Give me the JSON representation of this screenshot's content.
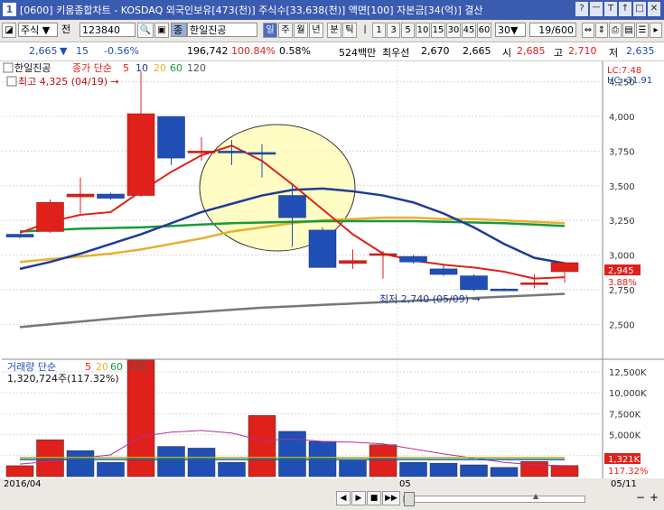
{
  "window": {
    "icon_label": "1",
    "title": "[0600] 키움종합차트 - KOSDAQ 외국인보유[473(천)] 주식수[33,638(천)] 액면[100] 자본금[34(억)] 결산",
    "buttons": [
      "?",
      "ㅡ",
      "T",
      "↑",
      "□",
      "✕"
    ]
  },
  "toolbar": {
    "market": "주식",
    "prev_label": "전",
    "code": "123840",
    "name": "한일진공",
    "search_icon": "search-icon",
    "period_tabs": [
      "일",
      "주",
      "월",
      "년",
      "분",
      "틱"
    ],
    "active_period": "일",
    "intervals": [
      "1",
      "3",
      "5",
      "10",
      "15",
      "30",
      "45",
      "60"
    ],
    "count_value": "30",
    "page_counter": "19/600"
  },
  "quote": {
    "price": "2,665",
    "change": "15",
    "change_pct": "-0.56%",
    "volume": "196,742",
    "vol_ratio": "100.84%",
    "turnover": "0.58%",
    "amount": "524백만",
    "best_bid_label": "최우선",
    "best_bid": "2,670",
    "best_ask": "2,665",
    "open_label": "시",
    "open": "2,685",
    "high_label": "고",
    "high": "2,710",
    "low_label": "저",
    "low": "2,635"
  },
  "colors": {
    "up": "#e0201a",
    "down": "#1f4fb5",
    "ma5": "#e0201a",
    "ma10": "#1f3a9a",
    "ma20": "#e8b030",
    "ma60": "#1a9a3a",
    "ma120": "#777777"
  },
  "chart_data": [
    {
      "type": "candlestick",
      "title": "한일진공",
      "legend": {
        "prefix": "종가 단순",
        "periods": [
          "5",
          "10",
          "20",
          "60",
          "120"
        ]
      },
      "annotations": {
        "high": "최고 4,325 (04/19) →",
        "low": "최저 2,740 (05/09) →",
        "lc": "LC:7.48",
        "hc": "HC:-31.91",
        "last_price": "2,945",
        "last_pct": "3.88%"
      },
      "ylim": [
        2300,
        4300
      ],
      "y_ticks": [
        "4,250",
        "4,000",
        "3,750",
        "3,500",
        "3,250",
        "3,000",
        "2,750",
        "2,500"
      ],
      "y_tick_values": [
        4250,
        4000,
        3750,
        3500,
        3250,
        3000,
        2750,
        2500
      ],
      "x_labels": [
        "2016/04",
        "05",
        "05/11"
      ],
      "candles": [
        {
          "o": 3150,
          "h": 3150,
          "l": 3120,
          "c": 3130
        },
        {
          "o": 3170,
          "h": 3400,
          "l": 3160,
          "c": 3380
        },
        {
          "o": 3420,
          "h": 3560,
          "l": 3300,
          "c": 3440
        },
        {
          "o": 3440,
          "h": 3450,
          "l": 3400,
          "c": 3410
        },
        {
          "o": 3430,
          "h": 4325,
          "l": 3420,
          "c": 4020
        },
        {
          "o": 4000,
          "h": 4000,
          "l": 3650,
          "c": 3700
        },
        {
          "o": 3750,
          "h": 3850,
          "l": 3680,
          "c": 3750
        },
        {
          "o": 3750,
          "h": 3830,
          "l": 3650,
          "c": 3740
        },
        {
          "o": 3740,
          "h": 3800,
          "l": 3560,
          "c": 3730
        },
        {
          "o": 3430,
          "h": 3520,
          "l": 3060,
          "c": 3270
        },
        {
          "o": 3180,
          "h": 3200,
          "l": 2910,
          "c": 2910
        },
        {
          "o": 2940,
          "h": 3040,
          "l": 2900,
          "c": 2960
        },
        {
          "o": 3000,
          "h": 3030,
          "l": 2830,
          "c": 3010
        },
        {
          "o": 2990,
          "h": 3000,
          "l": 2940,
          "c": 2950
        },
        {
          "o": 2900,
          "h": 2930,
          "l": 2850,
          "c": 2860
        },
        {
          "o": 2850,
          "h": 2860,
          "l": 2740,
          "c": 2750
        },
        {
          "o": 2755,
          "h": 2760,
          "l": 2745,
          "c": 2750
        },
        {
          "o": 2800,
          "h": 2860,
          "l": 2760,
          "c": 2800
        },
        {
          "o": 2880,
          "h": 2950,
          "l": 2800,
          "c": 2945
        }
      ],
      "ma5": [
        3160,
        3240,
        3290,
        3310,
        3460,
        3600,
        3720,
        3790,
        3680,
        3510,
        3330,
        3150,
        3010,
        2960,
        2930,
        2910,
        2880,
        2830,
        2840
      ],
      "ma10": [
        2900,
        2950,
        3010,
        3080,
        3150,
        3230,
        3310,
        3370,
        3430,
        3470,
        3480,
        3460,
        3430,
        3380,
        3300,
        3200,
        3080,
        2980,
        2940
      ],
      "ma20": [
        2950,
        2970,
        2990,
        3010,
        3040,
        3080,
        3120,
        3170,
        3200,
        3230,
        3250,
        3260,
        3270,
        3270,
        3260,
        3260,
        3250,
        3240,
        3230
      ],
      "ma60": [
        3170,
        3180,
        3190,
        3195,
        3200,
        3210,
        3220,
        3230,
        3235,
        3240,
        3245,
        3245,
        3245,
        3245,
        3240,
        3235,
        3230,
        3220,
        3210
      ],
      "ma120": [
        2480,
        2500,
        2520,
        2540,
        2560,
        2575,
        2590,
        2605,
        2620,
        2630,
        2640,
        2650,
        2660,
        2670,
        2680,
        2690,
        2700,
        2710,
        2720
      ]
    },
    {
      "type": "bar",
      "title": "거래량 단순",
      "legend": {
        "periods": [
          "5",
          "20",
          "60",
          "120"
        ]
      },
      "subtitle": "1,320,724주(117.32%)",
      "ylim": [
        0,
        14000
      ],
      "y_ticks": [
        "12,500K",
        "10,000K",
        "7,500K",
        "5,000K",
        "2,500K"
      ],
      "y_tick_values": [
        12500,
        10000,
        7500,
        5000,
        2500
      ],
      "last_label": "1,321K",
      "last_pct": "117.32%",
      "volumes": [
        1300,
        4400,
        3100,
        1700,
        13900,
        3600,
        3400,
        1700,
        7300,
        5400,
        4200,
        1900,
        3800,
        1700,
        1600,
        1400,
        1100,
        1800,
        1321
      ],
      "up_flags": [
        1,
        1,
        0,
        0,
        1,
        0,
        0,
        0,
        1,
        0,
        0,
        0,
        1,
        0,
        0,
        0,
        0,
        1,
        1
      ],
      "ma5_line": [
        1500,
        1800,
        2200,
        2600,
        4800,
        5300,
        5500,
        5200,
        4300,
        4500,
        4200,
        4100,
        3900,
        3300,
        2700,
        2200,
        1700,
        1400,
        1300
      ]
    }
  ],
  "bottom": {
    "date_left": "2016/04",
    "date_mid": "05",
    "date_right": "05/11",
    "nav_buttons": [
      "◀",
      "▶",
      "■",
      "▶▶",
      "|◀",
      "▶|"
    ],
    "zoom_minus": "−",
    "zoom_plus": "+",
    "zoom_arrow": "▲"
  }
}
